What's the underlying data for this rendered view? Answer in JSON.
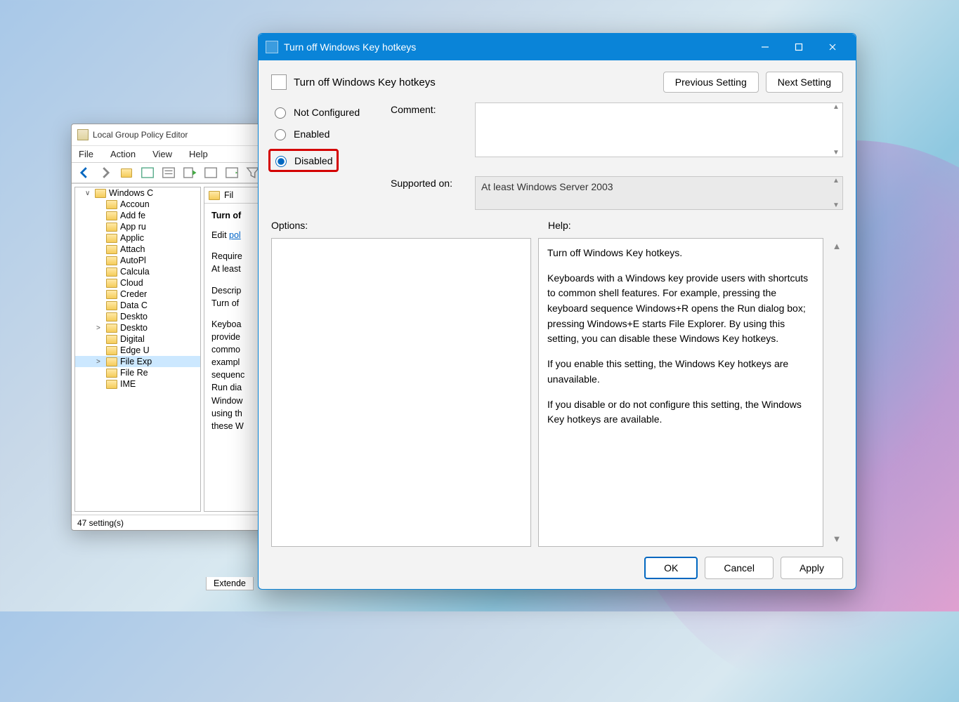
{
  "gp": {
    "title": "Local Group Policy Editor",
    "menu": [
      "File",
      "Action",
      "View",
      "Help"
    ],
    "tree_root": "Windows C",
    "tree_items": [
      {
        "label": "Accoun"
      },
      {
        "label": "Add fe"
      },
      {
        "label": "App ru"
      },
      {
        "label": "Applic"
      },
      {
        "label": "Attach"
      },
      {
        "label": "AutoPl"
      },
      {
        "label": "Calcula"
      },
      {
        "label": "Cloud"
      },
      {
        "label": "Creder"
      },
      {
        "label": "Data C"
      },
      {
        "label": "Deskto"
      },
      {
        "label": "Deskto",
        "caret": ">"
      },
      {
        "label": "Digital"
      },
      {
        "label": "Edge U"
      },
      {
        "label": "File Exp",
        "caret": ">",
        "selected": true
      },
      {
        "label": "File Re"
      },
      {
        "label": "IME"
      }
    ],
    "breadcrumb": "Fil",
    "detail_title": "Turn of",
    "edit_prefix": "Edit ",
    "edit_link": "pol",
    "require": "Require",
    "atleast": "At least",
    "descrip": "Descrip",
    "turn": "Turn of",
    "body_lines": [
      "Keyboa",
      "provide",
      "commo",
      "exampl",
      "sequenc",
      "Run dia",
      "Window",
      "using th",
      "these W"
    ],
    "tab": "Extende",
    "status": "47 setting(s)"
  },
  "dlg": {
    "title": "Turn off Windows Key hotkeys",
    "policy_title": "Turn off Windows Key hotkeys",
    "prev_btn": "Previous Setting",
    "next_btn": "Next Setting",
    "radio_not": "Not Configured",
    "radio_enabled": "Enabled",
    "radio_disabled": "Disabled",
    "comment_lbl": "Comment:",
    "supported_lbl": "Supported on:",
    "supported_val": "At least Windows Server 2003",
    "options_lbl": "Options:",
    "help_lbl": "Help:",
    "help": {
      "p1": "Turn off Windows Key hotkeys.",
      "p2": "Keyboards with a Windows key provide users with shortcuts to common shell features. For example, pressing the keyboard sequence Windows+R opens the Run dialog box; pressing Windows+E starts File Explorer. By using this setting, you can disable these Windows Key hotkeys.",
      "p3": "If you enable this setting, the Windows Key hotkeys are unavailable.",
      "p4": "If you disable or do not configure this setting, the Windows Key hotkeys are available."
    },
    "ok": "OK",
    "cancel": "Cancel",
    "apply": "Apply"
  }
}
